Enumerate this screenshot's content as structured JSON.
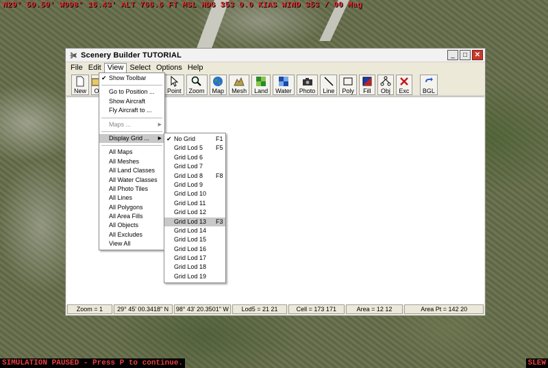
{
  "sim": {
    "top_hud": "N29° 50.50' W098° 16.43' ALT 766.6 FT MSL HDG 353 0.0 KIAS WIND 353 / 00 Mag",
    "paused_text": "SIMULATION PAUSED - Press P to continue.",
    "slew_text": "SLEW"
  },
  "window": {
    "title": "Scenery Builder  TUTORIAL",
    "min_glyph": "_",
    "max_glyph": "□",
    "close_glyph": "✕"
  },
  "menubar": {
    "items": [
      {
        "label": "File"
      },
      {
        "label": "Edit"
      },
      {
        "label": "View"
      },
      {
        "label": "Select"
      },
      {
        "label": "Options"
      },
      {
        "label": "Help"
      }
    ]
  },
  "toolbar": {
    "tools": [
      {
        "label": "New",
        "icon": "page-icon"
      },
      {
        "label": "O",
        "icon": "open-icon"
      },
      {
        "label": "Point",
        "icon": "pointer-icon"
      },
      {
        "label": "Zoom",
        "icon": "magnifier-icon"
      },
      {
        "label": "Map",
        "icon": "globe-icon"
      },
      {
        "label": "Mesh",
        "icon": "mesh-icon"
      },
      {
        "label": "Land",
        "icon": "land-icon"
      },
      {
        "label": "Water",
        "icon": "water-icon"
      },
      {
        "label": "Photo",
        "icon": "camera-icon"
      },
      {
        "label": "Line",
        "icon": "line-icon"
      },
      {
        "label": "Poly",
        "icon": "polygon-icon"
      },
      {
        "label": "Fill",
        "icon": "fill-icon"
      },
      {
        "label": "Obj",
        "icon": "object-icon"
      },
      {
        "label": "Exc",
        "icon": "exclude-icon"
      },
      {
        "label": "BGL",
        "icon": "compile-icon"
      }
    ]
  },
  "view_menu": {
    "show_toolbar": "Show Toolbar",
    "go_to_position": "Go to Position ...",
    "show_aircraft": "Show Aircraft",
    "fly_aircraft_to": "Fly Aircraft to ...",
    "maps": "Maps ...",
    "display_grid": "Display Grid ...",
    "all_items": [
      "All Maps",
      "All Meshes",
      "All Land Classes",
      "All Water Classes",
      "All Photo Tiles",
      "All Lines",
      "All Polygons",
      "All Area Fills",
      "All Objects",
      "All Excludes",
      "View All"
    ]
  },
  "grid_menu": {
    "items": [
      {
        "label": "No Grid",
        "key": "F1",
        "checked": true
      },
      {
        "label": "Grid Lod 5",
        "key": "F5"
      },
      {
        "label": "Grid Lod 6",
        "key": ""
      },
      {
        "label": "Grid Lod 7",
        "key": ""
      },
      {
        "label": "Grid Lod 8",
        "key": "F8"
      },
      {
        "label": "Grid Lod 9",
        "key": ""
      },
      {
        "label": "Grid Lod 10",
        "key": ""
      },
      {
        "label": "Grid Lod 11",
        "key": ""
      },
      {
        "label": "Grid Lod 12",
        "key": ""
      },
      {
        "label": "Grid Lod 13",
        "key": "F3",
        "highlighted": true
      },
      {
        "label": "Grid Lod 14",
        "key": ""
      },
      {
        "label": "Grid Lod 15",
        "key": ""
      },
      {
        "label": "Grid Lod 16",
        "key": ""
      },
      {
        "label": "Grid Lod 17",
        "key": ""
      },
      {
        "label": "Grid Lod 18",
        "key": ""
      },
      {
        "label": "Grid Lod 19",
        "key": ""
      }
    ]
  },
  "statusbar": {
    "zoom": "Zoom = 1",
    "lat": "29° 45' 00.3418\" N",
    "lon": "98° 43' 20.3501\" W",
    "lod": "Lod5 = 21 21",
    "cell": "Cell = 173 171",
    "area": "Area = 12 12",
    "area_pt": "Area Pt = 142 20"
  }
}
